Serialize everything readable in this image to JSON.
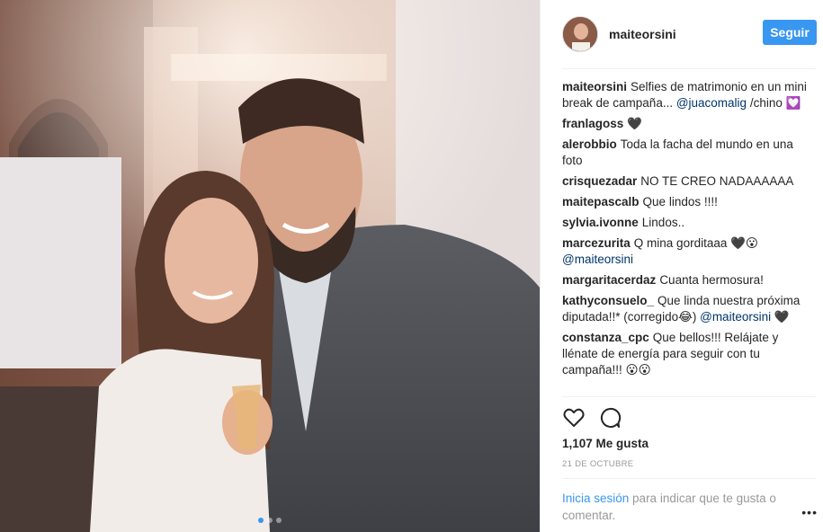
{
  "header": {
    "username": "maiteorsini",
    "follow_label": "Seguir"
  },
  "caption": {
    "user": "maiteorsini",
    "text": "Selfies de matrimonio en un mini break de campaña... ",
    "mention": "@juacomalig",
    "tail": " /chino 💟"
  },
  "comments": [
    {
      "user": "franlagoss",
      "text": "🖤"
    },
    {
      "user": "alerobbio",
      "text": "Toda la facha del mundo en una foto"
    },
    {
      "user": "crisquezadar",
      "text": "NO TE CREO NADAAAAAA"
    },
    {
      "user": "maitepascalb",
      "text": "Que lindos !!!!"
    },
    {
      "user": "sylvia.ivonne",
      "text": "Lindos.."
    },
    {
      "user": "marcezurita",
      "text": "Q mina gorditaaa 🖤😮 ",
      "mention": "@maiteorsini"
    },
    {
      "user": "margaritacerdaz",
      "text": "Cuanta hermosura!"
    },
    {
      "user": "kathyconsuelo_",
      "text": "Que linda nuestra próxima diputada!!* (corregido😂) ",
      "mention": "@maiteorsini",
      "tail": " 🖤"
    },
    {
      "user": "constanza_cpc",
      "text": "Que bellos!!! Relájate y llénate de energía para seguir con tu campaña!!! 😮😮"
    }
  ],
  "actions": {
    "like_icon": "heart-icon",
    "comment_icon": "comment-icon"
  },
  "likes_text": "1,107 Me gusta",
  "date_text": "21 DE OCTUBRE",
  "login_prompt": {
    "link": "Inicia sesión",
    "text": " para indicar que te gusta o comentar."
  },
  "more_label": "•••",
  "carousel": {
    "count": 3,
    "active": 1
  },
  "colors": {
    "accent": "#3897f0",
    "mention": "#003569"
  }
}
